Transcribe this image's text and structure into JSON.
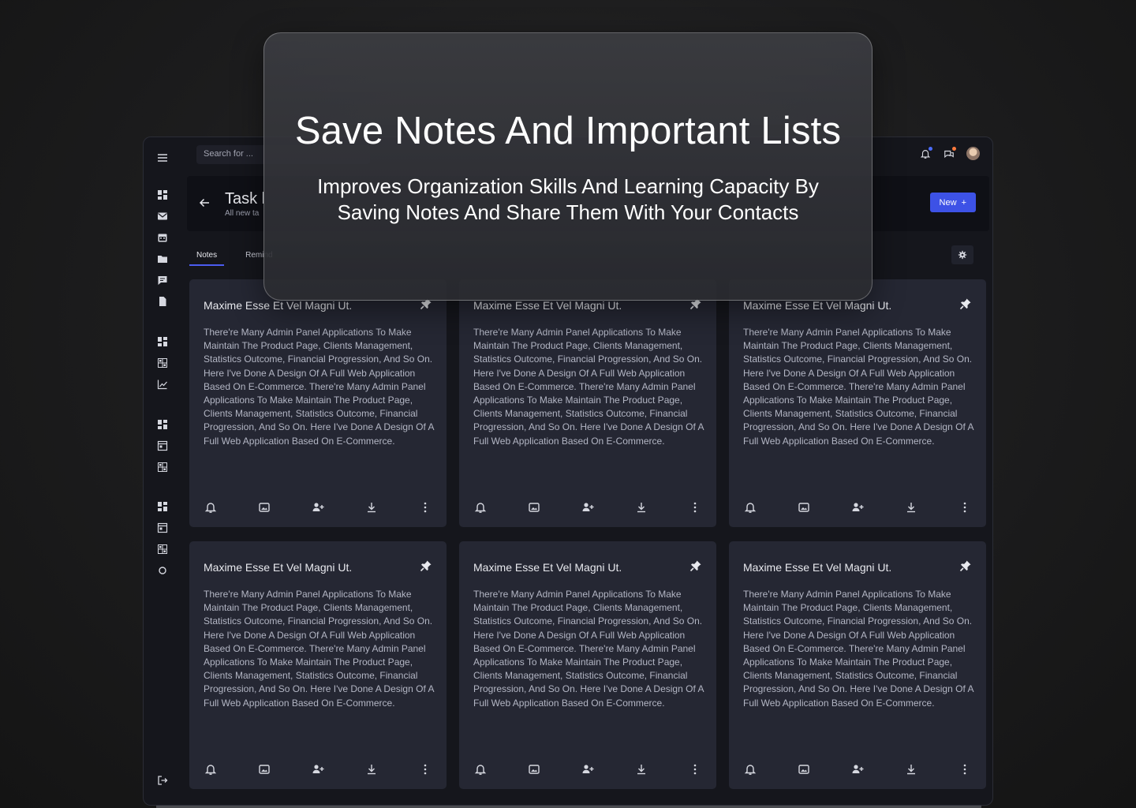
{
  "overlay": {
    "heading": "Save Notes And Important Lists",
    "subheading_line1": "Improves Organization Skills And Learning Capacity By",
    "subheading_line2": "Saving Notes And Share Them With Your Contacts"
  },
  "search": {
    "placeholder": "Search for ..."
  },
  "header": {
    "title": "Task l",
    "subtitle": "All new ta",
    "new_button": "New",
    "new_button_icon": "+"
  },
  "tabs": [
    {
      "label": "Notes",
      "active": true
    },
    {
      "label": "Remind",
      "active": false
    }
  ],
  "cards": [
    {
      "title": "Maxime Esse Et Vel Magni Ut.",
      "body": "There're Many Admin Panel Applications To Make Maintain The Product Page, Clients Management, Statistics Outcome, Financial Progression, And So On. Here I've Done A Design Of A Full Web Application Based On E-Commerce. There're Many Admin Panel Applications To Make Maintain The Product Page, Clients Management, Statistics Outcome, Financial Progression, And So On. Here I've Done A Design Of A Full Web Application Based On E-Commerce."
    },
    {
      "title": "Maxime Esse Et Vel Magni Ut.",
      "body": "There're Many Admin Panel Applications To Make Maintain The Product Page, Clients Management, Statistics Outcome, Financial Progression, And So On. Here I've Done A Design Of A Full Web Application Based On E-Commerce. There're Many Admin Panel Applications To Make Maintain The Product Page, Clients Management, Statistics Outcome, Financial Progression, And So On. Here I've Done A Design Of A Full Web Application Based On E-Commerce."
    },
    {
      "title": "Maxime Esse Et Vel Magni Ut.",
      "body": "There're Many Admin Panel Applications To Make Maintain The Product Page, Clients Management, Statistics Outcome, Financial Progression, And So On. Here I've Done A Design Of A Full Web Application Based On E-Commerce. There're Many Admin Panel Applications To Make Maintain The Product Page, Clients Management, Statistics Outcome, Financial Progression, And So On. Here I've Done A Design Of A Full Web Application Based On E-Commerce."
    },
    {
      "title": "Maxime Esse Et Vel Magni Ut.",
      "body": "There're Many Admin Panel Applications To Make Maintain The Product Page, Clients Management, Statistics Outcome, Financial Progression, And So On. Here I've Done A Design Of A Full Web Application Based On E-Commerce. There're Many Admin Panel Applications To Make Maintain The Product Page, Clients Management, Statistics Outcome, Financial Progression, And So On. Here I've Done A Design Of A Full Web Application Based On E-Commerce."
    },
    {
      "title": "Maxime Esse Et Vel Magni Ut.",
      "body": "There're Many Admin Panel Applications To Make Maintain The Product Page, Clients Management, Statistics Outcome, Financial Progression, And So On. Here I've Done A Design Of A Full Web Application Based On E-Commerce. There're Many Admin Panel Applications To Make Maintain The Product Page, Clients Management, Statistics Outcome, Financial Progression, And So On. Here I've Done A Design Of A Full Web Application Based On E-Commerce."
    },
    {
      "title": "Maxime Esse Et Vel Magni Ut.",
      "body": "There're Many Admin Panel Applications To Make Maintain The Product Page, Clients Management, Statistics Outcome, Financial Progression, And So On. Here I've Done A Design Of A Full Web Application Based On E-Commerce. There're Many Admin Panel Applications To Make Maintain The Product Page, Clients Management, Statistics Outcome, Financial Progression, And So On. Here I've Done A Design Of A Full Web Application Based On E-Commerce."
    }
  ],
  "icons": {
    "sidebar": [
      "menu-icon",
      "dashboard-icon",
      "mail-icon",
      "calendar-icon",
      "folder-icon",
      "chat-icon",
      "document-icon",
      "dashboard-icon",
      "grid-icon",
      "chart-line-icon",
      "dashboard-icon",
      "window-icon",
      "grid-icon",
      "dashboard-icon",
      "window-icon",
      "grid-icon",
      "circle-icon",
      "logout-icon"
    ],
    "card_actions": [
      "bell-icon",
      "image-icon",
      "add-user-icon",
      "download-icon",
      "more-vertical-icon"
    ],
    "topbar": [
      "bell-icon",
      "chat-icon",
      "avatar"
    ]
  },
  "colors": {
    "accent": "#3d52e6",
    "card": "#252733",
    "app_bg": "#15161c",
    "notification_dot_blue": "#4b6cff",
    "notification_dot_orange": "#ff7a3d"
  }
}
